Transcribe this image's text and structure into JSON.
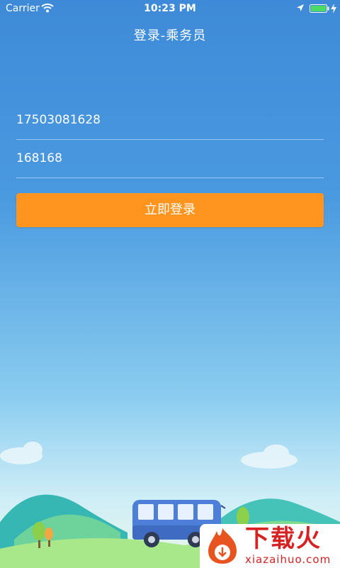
{
  "status_bar": {
    "carrier": "Carrier",
    "time": "10:23 PM",
    "icons": [
      "wifi-icon",
      "location-arrow-icon",
      "battery-icon",
      "charging-bolt-icon"
    ],
    "battery_color": "#4cd964"
  },
  "header": {
    "title": "登录-乘务员"
  },
  "form": {
    "phone_value": "17503081628",
    "password_value": "168168",
    "login_label": "立即登录"
  },
  "colors": {
    "accent_button": "#ff951f",
    "background_top": "#3e8ad8",
    "background_bottom": "#eaf8e8"
  },
  "illustration": {
    "icons": [
      "bus-icon",
      "hills-icon",
      "tree-icon",
      "cloud-icon"
    ]
  },
  "watermark": {
    "title": "下载火",
    "subtitle": "xiazaihuo.com"
  }
}
